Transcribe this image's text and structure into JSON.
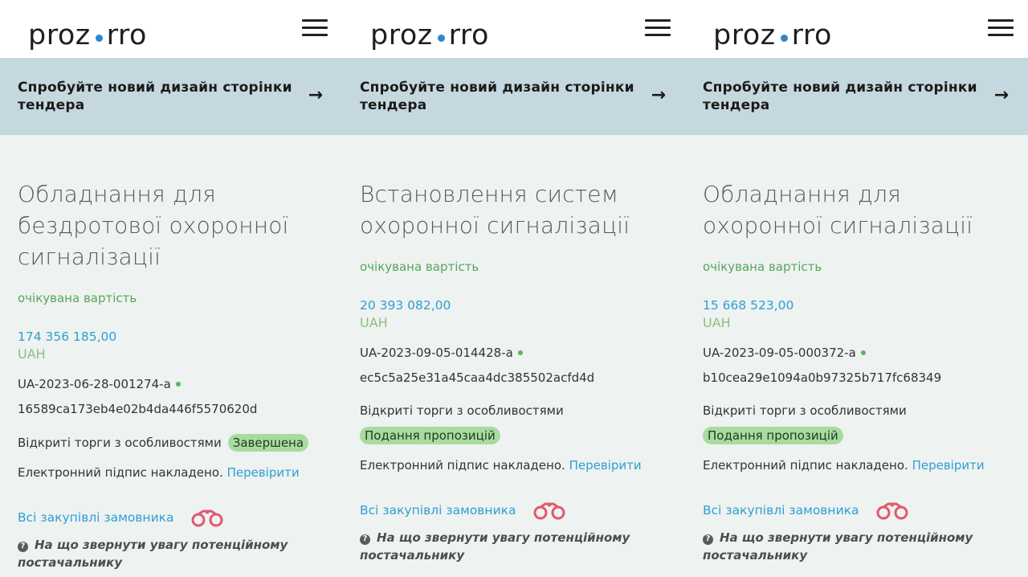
{
  "logo": {
    "left": "proz",
    "right": "rro"
  },
  "banner": {
    "text": "Спробуйте новий дизайн сторінки тендера",
    "arrow": "→"
  },
  "panels": [
    {
      "title": "Обладнання для бездротової охоронної сигналізації",
      "expected_label": "очікувана вартість",
      "price": "174 356 185,00",
      "currency": "UAH",
      "tender_id": "UA-2023-06-28-001274-a",
      "hash": "16589ca173eb4e02b4da446f5570620d",
      "procedure_type": "Відкриті торги з особливостями",
      "status": "Завершена",
      "signature_text": "Електронний підпис накладено.",
      "verify_link": "Перевірити",
      "all_purchases": "Всі закупівлі замовника",
      "hint": "На що звернути увагу потенційному постачальнику"
    },
    {
      "title": "Встановлення систем охоронної сигналізації",
      "expected_label": "очікувана вартість",
      "price": "20 393 082,00",
      "currency": "UAH",
      "tender_id": "UA-2023-09-05-014428-a",
      "hash": "ec5c5a25e31a45caa4dc385502acfd4d",
      "procedure_type": "Відкриті торги з особливостями",
      "status": "Подання пропозицій",
      "signature_text": "Електронний підпис накладено.",
      "verify_link": "Перевірити",
      "all_purchases": "Всі закупівлі замовника",
      "hint": "На що звернути увагу потенційному постачальнику"
    },
    {
      "title": "Обладнання для охоронної сигналізації",
      "expected_label": "очікувана вартість",
      "price": "15 668 523,00",
      "currency": "UAH",
      "tender_id": "UA-2023-09-05-000372-a",
      "hash": "b10cea29e1094a0b97325b717fc68349",
      "procedure_type": "Відкриті торги з особливостями",
      "status": "Подання пропозицій",
      "signature_text": "Електронний підпис накладено.",
      "verify_link": "Перевірити",
      "all_purchases": "Всі закупівлі замовника",
      "hint": "На що звернути увагу потенційному постачальнику"
    }
  ],
  "colors": {
    "accent_blue": "#2e9fd3",
    "green_label": "#58a55c",
    "status_badge": "#a9dba0",
    "banner_bg": "#c5d8df"
  },
  "icons": [
    "menu-icon",
    "arrow-right-icon",
    "binoculars-icon",
    "question-icon"
  ]
}
